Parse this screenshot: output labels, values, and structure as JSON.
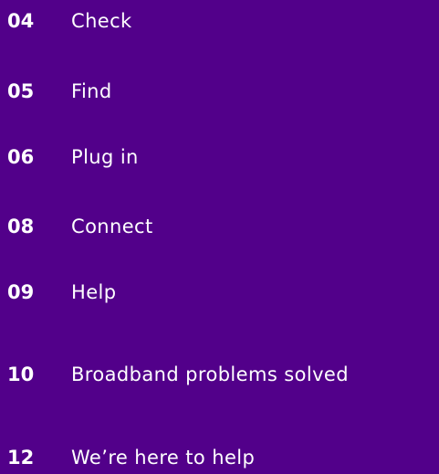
{
  "contents": {
    "items": [
      {
        "number": "04",
        "label": "Check"
      },
      {
        "number": "05",
        "label": "Find"
      },
      {
        "number": "06",
        "label": "Plug in"
      },
      {
        "number": "08",
        "label": "Connect"
      },
      {
        "number": "09",
        "label": "Help"
      },
      {
        "number": "10",
        "label": "Broadband problems solved"
      },
      {
        "number": "12",
        "label": "We’re here to help"
      }
    ]
  },
  "colors": {
    "background": "#52008a",
    "text": "#ffffff"
  }
}
